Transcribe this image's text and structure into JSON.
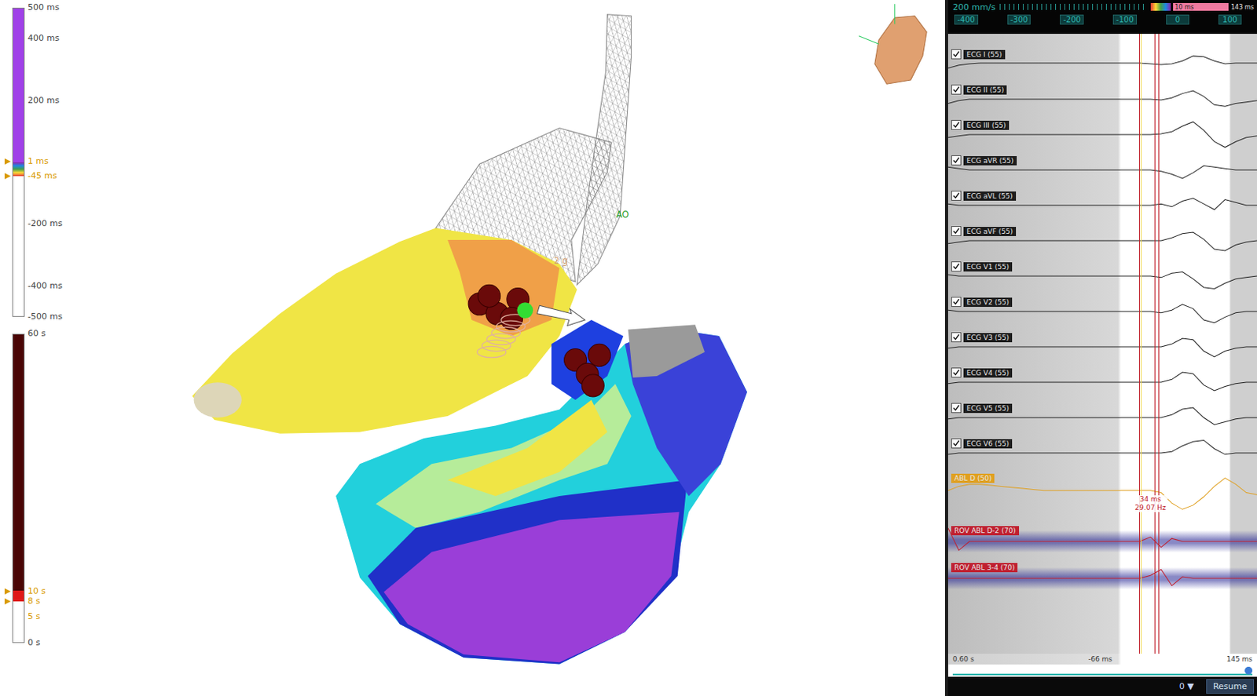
{
  "lat_scale": {
    "ticks": [
      {
        "label": "500 ms",
        "marker": false,
        "color": "#444444"
      },
      {
        "label": "400 ms",
        "marker": false,
        "color": "#444444"
      },
      {
        "label": "200 ms",
        "marker": false,
        "color": "#444444"
      },
      {
        "label": "1 ms",
        "marker": true,
        "color": "#d99a00"
      },
      {
        "label": "-45 ms",
        "marker": true,
        "color": "#d99a00"
      },
      {
        "label": "-200 ms",
        "marker": false,
        "color": "#444444"
      },
      {
        "label": "-400 ms",
        "marker": false,
        "color": "#444444"
      },
      {
        "label": "-500 ms",
        "marker": false,
        "color": "#444444"
      }
    ]
  },
  "time_scale": {
    "ticks": [
      {
        "label": "60 s",
        "marker": false,
        "color": "#444444"
      },
      {
        "label": "10 s",
        "marker": true,
        "color": "#d99a00"
      },
      {
        "label": "8 s",
        "marker": true,
        "color": "#d99a00"
      },
      {
        "label": "5 s",
        "marker": false,
        "color": "#d99a00"
      },
      {
        "label": "0 s",
        "marker": false,
        "color": "#444444"
      }
    ]
  },
  "map": {
    "labels": [
      {
        "text": "AO",
        "color": "#1f9e2a"
      },
      {
        "text": "2 g",
        "color": "#d4a070"
      }
    ]
  },
  "signals": {
    "speed": "200 mm/s",
    "window_start": "10 ms",
    "window_end": "143 ms",
    "ruler_ticks": [
      "-400",
      "-300",
      "-200",
      "-100",
      "0",
      "100"
    ],
    "channels": [
      {
        "label": "ECG I (55)",
        "kind": "ecg",
        "checked": true,
        "color": "#222222",
        "values": [
          -0.3,
          -0.1,
          0,
          0.05,
          0.05,
          0.05,
          0.05,
          0.05,
          0.05,
          0.05,
          0.05,
          0.05,
          0.05,
          0.05,
          0.05,
          0.05,
          0.05,
          0.05,
          0.05,
          0,
          -0.05,
          0,
          0.2,
          0.55,
          0.5,
          0.2,
          0,
          0.05,
          0.05,
          0.05
        ]
      },
      {
        "label": "ECG II (55)",
        "kind": "ecg",
        "checked": true,
        "color": "#222222",
        "values": [
          -0.3,
          -0.1,
          0,
          0,
          0,
          0,
          0,
          0,
          0,
          0,
          0,
          0,
          0,
          0,
          0,
          0,
          0,
          0,
          0,
          0,
          -0.05,
          0.1,
          0.4,
          0.6,
          0.2,
          -0.4,
          -0.5,
          -0.3,
          -0.2,
          -0.1
        ]
      },
      {
        "label": "ECG III (55)",
        "kind": "ecg",
        "checked": true,
        "color": "#222222",
        "values": [
          -0.2,
          -0.1,
          0,
          0,
          0,
          0,
          0,
          0,
          0,
          0,
          0,
          0,
          0,
          0,
          0,
          0,
          0,
          0,
          0,
          0,
          0.05,
          0.2,
          0.6,
          0.9,
          0.3,
          -0.5,
          -0.9,
          -0.5,
          -0.2,
          -0.1
        ]
      },
      {
        "label": "ECG aVR (55)",
        "kind": "ecg",
        "checked": true,
        "color": "#222222",
        "values": [
          0.2,
          0.1,
          0,
          0,
          0,
          0,
          0,
          0,
          0,
          0,
          0,
          0,
          0,
          0,
          0,
          0,
          0,
          0,
          0,
          0,
          -0.1,
          -0.3,
          -0.6,
          -0.2,
          0.3,
          0.2,
          0.1,
          0,
          0,
          0
        ]
      },
      {
        "label": "ECG aVL (55)",
        "kind": "ecg",
        "checked": true,
        "color": "#222222",
        "values": [
          0.1,
          0,
          0,
          0,
          0,
          0,
          0,
          0,
          0,
          0,
          0,
          0,
          0,
          0,
          0,
          0,
          0,
          0,
          0,
          0,
          0.1,
          -0.1,
          0.3,
          0.5,
          0.1,
          -0.3,
          0.4,
          0.2,
          0,
          0
        ]
      },
      {
        "label": "ECG aVF (55)",
        "kind": "ecg",
        "checked": true,
        "color": "#222222",
        "values": [
          -0.2,
          -0.1,
          0,
          0,
          0,
          0,
          0,
          0,
          0,
          0,
          0,
          0,
          0,
          0,
          0,
          0,
          0,
          0,
          0,
          0,
          0,
          0.2,
          0.5,
          0.6,
          0.1,
          -0.6,
          -0.7,
          -0.3,
          -0.1,
          0
        ]
      },
      {
        "label": "ECG V1 (55)",
        "kind": "ecg",
        "checked": true,
        "color": "#222222",
        "values": [
          0.1,
          0,
          0,
          0,
          0,
          0,
          0,
          0,
          0,
          0,
          0,
          0,
          0,
          0,
          0,
          0,
          0,
          0,
          0,
          0,
          -0.1,
          0.2,
          0.3,
          -0.2,
          -0.8,
          -0.9,
          -0.5,
          -0.2,
          -0.1,
          0
        ]
      },
      {
        "label": "ECG V2 (55)",
        "kind": "ecg",
        "checked": true,
        "color": "#222222",
        "values": [
          0.1,
          0,
          0,
          0,
          0,
          0,
          0,
          0,
          0,
          0,
          0,
          0,
          0,
          0,
          0,
          0,
          0,
          0,
          0,
          0,
          -0.1,
          0.1,
          0.5,
          0.2,
          -0.6,
          -0.8,
          -0.4,
          -0.1,
          0,
          0
        ]
      },
      {
        "label": "ECG V3 (55)",
        "kind": "ecg",
        "checked": true,
        "color": "#222222",
        "values": [
          -0.1,
          0,
          0,
          0,
          0,
          0,
          0,
          0,
          0,
          0,
          0,
          0,
          0,
          0,
          0,
          0,
          0,
          0,
          0,
          0,
          0,
          0.2,
          0.6,
          0.5,
          -0.3,
          -0.7,
          -0.3,
          -0.1,
          0,
          0
        ]
      },
      {
        "label": "ECG V4 (55)",
        "kind": "ecg",
        "checked": true,
        "color": "#222222",
        "values": [
          -0.1,
          0,
          0,
          0,
          0,
          0,
          0,
          0,
          0,
          0,
          0,
          0,
          0,
          0,
          0,
          0,
          0,
          0,
          0,
          0,
          0,
          0.2,
          0.7,
          0.6,
          -0.2,
          -0.6,
          -0.3,
          -0.1,
          0,
          0
        ]
      },
      {
        "label": "ECG V5 (55)",
        "kind": "ecg",
        "checked": true,
        "color": "#222222",
        "values": [
          -0.1,
          0,
          0,
          0,
          0,
          0,
          0,
          0,
          0,
          0,
          0,
          0,
          0,
          0,
          0,
          0,
          0,
          0,
          0,
          0,
          0,
          0.2,
          0.6,
          0.7,
          0,
          -0.5,
          -0.3,
          -0.1,
          0,
          0
        ]
      },
      {
        "label": "ECG V6 (55)",
        "kind": "ecg",
        "checked": true,
        "color": "#222222",
        "values": [
          -0.1,
          0,
          0,
          0,
          0,
          0,
          0,
          0,
          0,
          0,
          0,
          0,
          0,
          0,
          0,
          0,
          0,
          0,
          0,
          0,
          0,
          0.1,
          0.5,
          0.8,
          0.9,
          0.3,
          -0.1,
          0,
          0,
          0
        ]
      },
      {
        "label": "ABL D (50)",
        "kind": "unipolar",
        "checked": false,
        "color": "#e0a020",
        "values": [
          0.3,
          0.5,
          0.6,
          0.6,
          0.55,
          0.5,
          0.45,
          0.4,
          0.35,
          0.3,
          0.3,
          0.3,
          0.3,
          0.3,
          0.3,
          0.3,
          0.3,
          0.3,
          0.3,
          0.3,
          0.2,
          -0.3,
          -0.6,
          -0.4,
          0,
          0.5,
          0.9,
          0.6,
          0.2,
          0.1
        ]
      },
      {
        "label": "ROV ABL D-2 (70)",
        "kind": "bipolar",
        "checked": false,
        "color": "#c02030",
        "values": [
          0.9,
          -0.6,
          0,
          0,
          0,
          0,
          0,
          0,
          0,
          0,
          0,
          0,
          0,
          0,
          0,
          0,
          0,
          0,
          0,
          0.3,
          -0.4,
          0.2,
          0,
          0,
          0,
          0,
          0,
          0,
          0,
          0
        ]
      },
      {
        "label": "ROV ABL 3-4 (70)",
        "kind": "bipolar",
        "checked": false,
        "color": "#c02030",
        "values": [
          0,
          0,
          0,
          0,
          0,
          0,
          0,
          0,
          0,
          0,
          0,
          0,
          0,
          0,
          0,
          0,
          0,
          0,
          0,
          0.2,
          0.6,
          -0.5,
          0.1,
          0,
          0,
          0,
          0,
          0,
          0,
          0
        ]
      }
    ],
    "measurement": {
      "interval": "34 ms",
      "rate": "29.07 Hz"
    },
    "footer": {
      "duration": "0.60 s",
      "start": "-66 ms",
      "end": "145 ms",
      "counter": "0",
      "counter_icon": "▼",
      "resume": "Resume"
    }
  }
}
